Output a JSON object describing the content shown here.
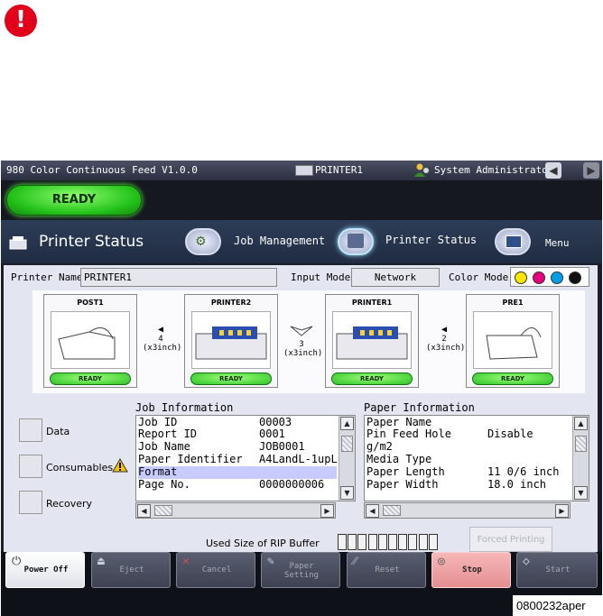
{
  "warning": {
    "glyph": "!",
    "color": "#e2001a"
  },
  "titlebar": {
    "app": "980 Color Continuous Feed  V1.0.0",
    "printer": "PRINTER1",
    "user": "System Administrator",
    "nav_prev": "◀",
    "nav_next": "▶"
  },
  "status": {
    "label": "READY"
  },
  "nav": {
    "page_title": "Printer Status",
    "tabs": [
      {
        "label": "Job Management",
        "icon": "job-management-icon"
      },
      {
        "label": "Printer Status",
        "icon": "printer-status-icon"
      },
      {
        "label": "Menu",
        "icon": "menu-icon"
      }
    ]
  },
  "printer_fields": {
    "printer_name_label": "Printer Name",
    "printer_name_value": "PRINTER1",
    "input_mode_label": "Input Mode",
    "input_mode_value": "Network",
    "color_mode_label": "Color Mode",
    "colors": [
      "#ffe600",
      "#e6007e",
      "#00a0e9",
      "#111111"
    ]
  },
  "devices": [
    {
      "name": "POST1",
      "status": "READY"
    },
    {
      "name": "PRINTER2",
      "status": "READY"
    },
    {
      "name": "PRINTER1",
      "status": "READY"
    },
    {
      "name": "PRE1",
      "status": "READY"
    }
  ],
  "connectors": [
    {
      "arrow": "◀",
      "num": "4",
      "unit": "(x3inch)"
    },
    {
      "arrow": "",
      "num": "3",
      "unit": "(x3inch)"
    },
    {
      "arrow": "◀",
      "num": "2",
      "unit": "(x3inch)"
    }
  ],
  "side_buttons": [
    {
      "label": "Data"
    },
    {
      "label": "Consumables",
      "warn": "!"
    },
    {
      "label": "Recovery"
    }
  ],
  "job_info": {
    "title": "Job Information",
    "rows": [
      {
        "k": "Job ID",
        "v": "00003"
      },
      {
        "k": "Report ID",
        "v": "0001"
      },
      {
        "k": "Job Name",
        "v": "JOB0001"
      },
      {
        "k": "Paper Identifier",
        "v": "A4LandL-1upL"
      },
      {
        "k": "Format",
        "v": ""
      },
      {
        "k": "Page No.",
        "v": "0000000006"
      }
    ]
  },
  "paper_info": {
    "title": "Paper Information",
    "rows": [
      {
        "k": "Paper Name",
        "v": ""
      },
      {
        "k": "Pin Feed Hole",
        "v": "Disable"
      },
      {
        "k": "g/m2",
        "v": ""
      },
      {
        "k": "Media Type",
        "v": ""
      },
      {
        "k": "Paper Length",
        "v": "11 0/6 inch"
      },
      {
        "k": "Paper Width",
        "v": "18.0 inch"
      }
    ]
  },
  "rip": {
    "label": "Used Size of RIP Buffer",
    "segments": 10
  },
  "forced_printing": "Forced Printing",
  "bottom_buttons": [
    {
      "label": "Power Off",
      "enabled": true
    },
    {
      "label": "Eject",
      "enabled": false
    },
    {
      "label": "Cancel",
      "enabled": false
    },
    {
      "label": "Paper Setting",
      "enabled": false
    },
    {
      "label": "Reset",
      "enabled": false
    },
    {
      "label": "Stop",
      "enabled": true
    },
    {
      "label": "Start",
      "enabled": false
    }
  ],
  "footer": "0800232aper"
}
